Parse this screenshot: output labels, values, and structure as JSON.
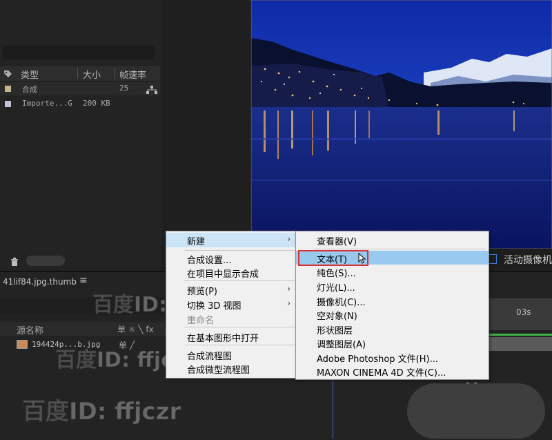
{
  "project": {
    "columns": {
      "type": "类型",
      "size": "大小",
      "fps": "帧速率"
    },
    "rows": [
      {
        "type": "合成",
        "size": "",
        "fps": "25",
        "swatch": "#c4b490"
      },
      {
        "type": "Importe...G",
        "size": "200 KB",
        "fps": "",
        "swatch": "#c2c2d8"
      }
    ]
  },
  "viewer": {
    "camera_label": "活动摄像机"
  },
  "timeline": {
    "tab_title": "41lif84.jpg.thumb",
    "menu_icon": "≡",
    "source_name_header": "源名称",
    "switch_icons": "单 ☼ ╲ fx",
    "layer_name": "194424p...b.jpg",
    "layer_switches": "单  ╱",
    "ruler_label": "03s"
  },
  "watermark": {
    "text": "百度ID: ffjczr"
  },
  "context_menu": {
    "items": [
      {
        "label": "新建",
        "has_submenu": true,
        "highlighted": true
      },
      {
        "label": "合成设置..."
      },
      {
        "label": "在项目中显示合成"
      },
      {
        "label": "预览(P)",
        "has_submenu": true
      },
      {
        "label": "切换 3D 视图",
        "has_submenu": true
      },
      {
        "label": "重命名",
        "disabled": true
      },
      {
        "label": "在基本图形中打开"
      },
      {
        "label": "合成流程图"
      },
      {
        "label": "合成微型流程图"
      }
    ]
  },
  "submenu": {
    "items": [
      {
        "label": "查看器(V)"
      },
      {
        "label": "文本(T)",
        "highlighted": true
      },
      {
        "label": "纯色(S)..."
      },
      {
        "label": "灯光(L)..."
      },
      {
        "label": "摄像机(C)..."
      },
      {
        "label": "空对象(N)"
      },
      {
        "label": "形状图层"
      },
      {
        "label": "调整图层(A)"
      },
      {
        "label": "Adobe Photoshop 文件(H)..."
      },
      {
        "label": "MAXON CINEMA 4D 文件(C)..."
      }
    ]
  },
  "colors": {
    "highlight": "#99c9ef",
    "annotation_box": "#d93030",
    "timeline_green": "#3eb544"
  }
}
